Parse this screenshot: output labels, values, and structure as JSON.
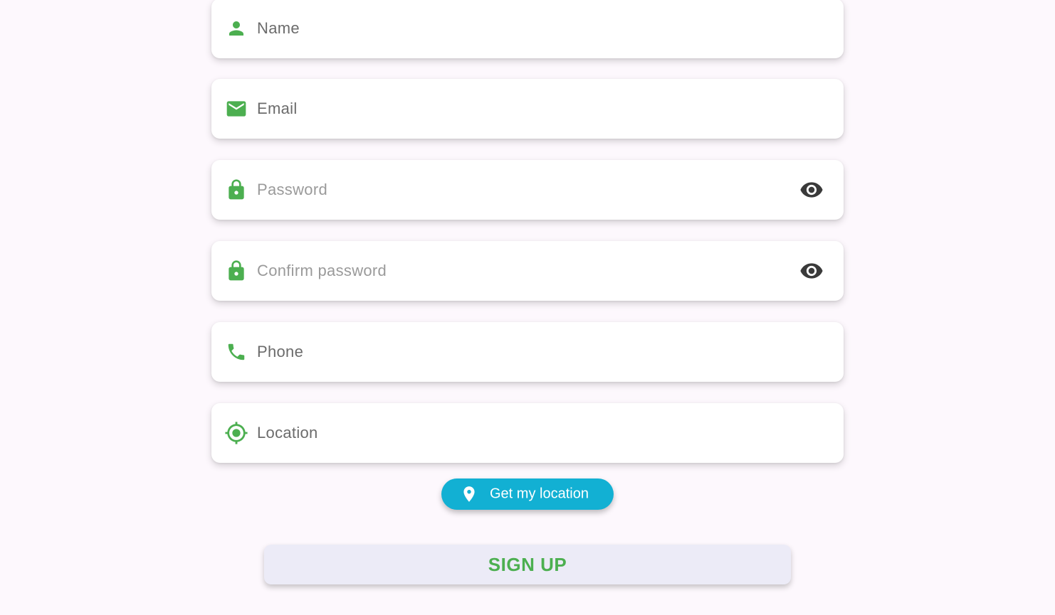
{
  "colors": {
    "accent_green": "#4caf50",
    "button_cyan": "#12b0d3",
    "signup_bg": "#ecebf7",
    "page_bg": "#fdf8fd"
  },
  "form": {
    "fields": [
      {
        "label": "Name",
        "icon": "person-icon",
        "style": "label"
      },
      {
        "label": "Email",
        "icon": "mail-icon",
        "style": "label"
      },
      {
        "label": "Password",
        "icon": "lock-icon",
        "style": "hint",
        "toggle_icon": "eye-icon"
      },
      {
        "label": "Confirm password",
        "icon": "lock-icon",
        "style": "hint",
        "toggle_icon": "eye-icon"
      },
      {
        "label": "Phone",
        "icon": "phone-icon",
        "style": "label"
      },
      {
        "label": "Location",
        "icon": "gps-target-icon",
        "style": "label"
      }
    ]
  },
  "location_button": {
    "label": "Get my location",
    "icon": "map-pin-icon"
  },
  "signup_button": {
    "label": "SIGN UP"
  }
}
